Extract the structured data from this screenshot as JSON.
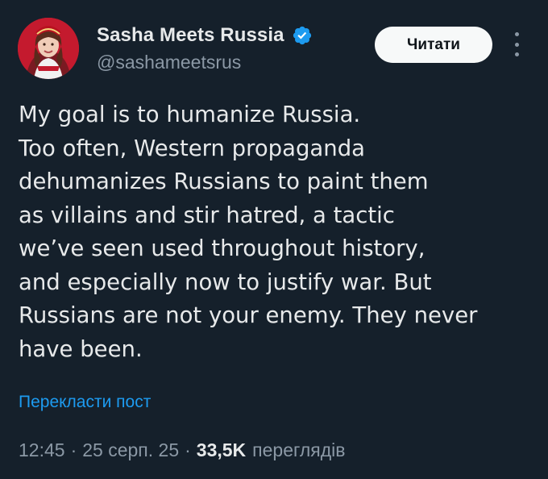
{
  "user": {
    "display_name": "Sasha Meets Russia",
    "handle": "@sashameetsrus",
    "verified": true,
    "verified_color": "#1d9bf0",
    "avatar_icon": "profile-photo"
  },
  "header": {
    "follow_label": "Читати",
    "more_icon": "more-vertical-icon"
  },
  "tweet": {
    "lines": [
      "My goal is to humanize Russia.",
      "Too often, Western propaganda",
      "dehumanizes Russians to paint them",
      "as villains and stir hatred, a tactic",
      "we’ve seen used throughout history,",
      "and especially now to justify war. But",
      "Russians are not your enemy. They never",
      "have been."
    ],
    "translate_label": "Перекласти пост"
  },
  "meta": {
    "time": "12:45",
    "separator": "·",
    "date": "25 серп. 25",
    "views_count": "33,5K",
    "views_label": "переглядів"
  },
  "colors": {
    "background": "#15202b",
    "text_primary": "#e7e9ea",
    "text_secondary": "#8b98a5",
    "link": "#1d9bf0"
  }
}
